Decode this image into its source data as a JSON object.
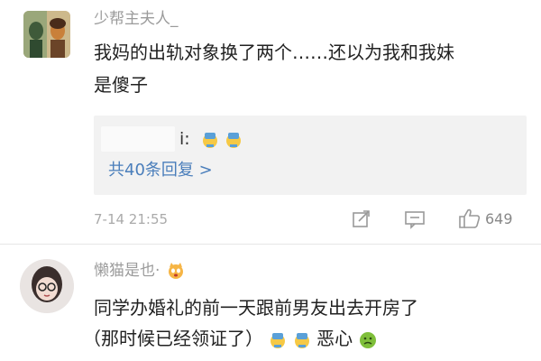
{
  "comment1": {
    "username": "少帮主夫人_",
    "line1": "我妈的出轨对象换了两个……还以为我和我妹",
    "line2": "是傻子",
    "reply": {
      "text": "i:",
      "count_label": "共40条回复 >"
    },
    "timestamp": "7-14 21:55",
    "likes": "649",
    "icons": [
      "share-icon",
      "comment-icon",
      "thumbs-up-icon"
    ]
  },
  "comment2": {
    "username": "懒猫是也·",
    "line1": "同学办婚礼的前一天跟前男友出去开房了",
    "line2_part1": "（那时候已经领证了）",
    "line2_part2": "恶心",
    "icons": [
      "sweat-emoji-icon",
      "nauseated-emoji-icon"
    ]
  },
  "colors": {
    "username": "#9b9b9b",
    "link": "#4a7ebb",
    "text": "#222222",
    "meta": "#aaaaaa"
  }
}
